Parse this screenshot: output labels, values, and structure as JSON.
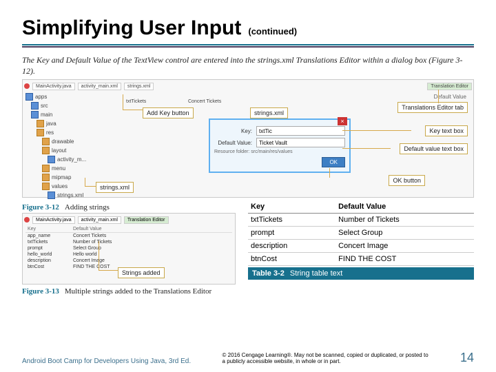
{
  "title": "Simplifying User Input",
  "continued": "(continued)",
  "caption": "The Key and Default Value of the TextView control are entered into the strings.xml Translations Editor within a dialog box (Figure 3-12).",
  "main": {
    "tabs": [
      "MainActivity.java",
      "activity_main.xml",
      "strings.xml"
    ],
    "editorTab": "Translation Editor",
    "headerRight": "Default Value",
    "tree": [
      "apps",
      "src",
      "main",
      "java",
      "res",
      "drawable",
      "layout",
      "activity_m...",
      "menu",
      "mipmap",
      "values",
      "strings.xml"
    ],
    "labels": {
      "addKey": "Add Key button",
      "stringsXml": "strings.xml",
      "editorTab": "Translations Editor tab",
      "keyBox": "Key text box",
      "defaultBox": "Default value text box",
      "okBtn": "OK button"
    },
    "midKey": "txtTickets",
    "midVal": "Concert Tickets",
    "dialog": {
      "keyLabel": "Key:",
      "keyVal": "txtTic",
      "defLabel": "Default Value:",
      "defVal": "Ticket Vault",
      "hint": "Resource folder:  src/main/res/values",
      "ok": "OK"
    }
  },
  "fig12": {
    "num": "Figure 3-12",
    "desc": "Adding strings"
  },
  "panel2": {
    "tabs": [
      "MainActivity.java",
      "activity_main.xml",
      "Translation Editor"
    ],
    "head": [
      "Key",
      "Default Value"
    ],
    "rows": [
      [
        "app_name",
        "Concert Tickets"
      ],
      [
        "txtTickets",
        "Number of Tickets"
      ],
      [
        "prompt",
        "Select Group"
      ],
      [
        "hello_world",
        "Hello world"
      ],
      [
        "description",
        "Concert Image"
      ],
      [
        "btnCost",
        "FIND THE COST"
      ]
    ],
    "callout": "Strings added"
  },
  "fig13": {
    "num": "Figure 3-13",
    "desc": "Multiple strings added to the Translations Editor"
  },
  "table": {
    "head": [
      "Key",
      "Default Value"
    ],
    "rows": [
      [
        "txtTickets",
        "Number of Tickets"
      ],
      [
        "prompt",
        "Select Group"
      ],
      [
        "description",
        "Concert Image"
      ],
      [
        "btnCost",
        "FIND THE COST"
      ]
    ],
    "footNum": "Table 3-2",
    "footDesc": "String table text"
  },
  "footer": {
    "left": "Android Boot Camp for Developers Using Java, 3rd Ed.",
    "copy": "© 2016 Cengage Learning®. May not be scanned, copied or duplicated, or posted to a publicly accessible website, in whole or in part.",
    "page": "14"
  }
}
